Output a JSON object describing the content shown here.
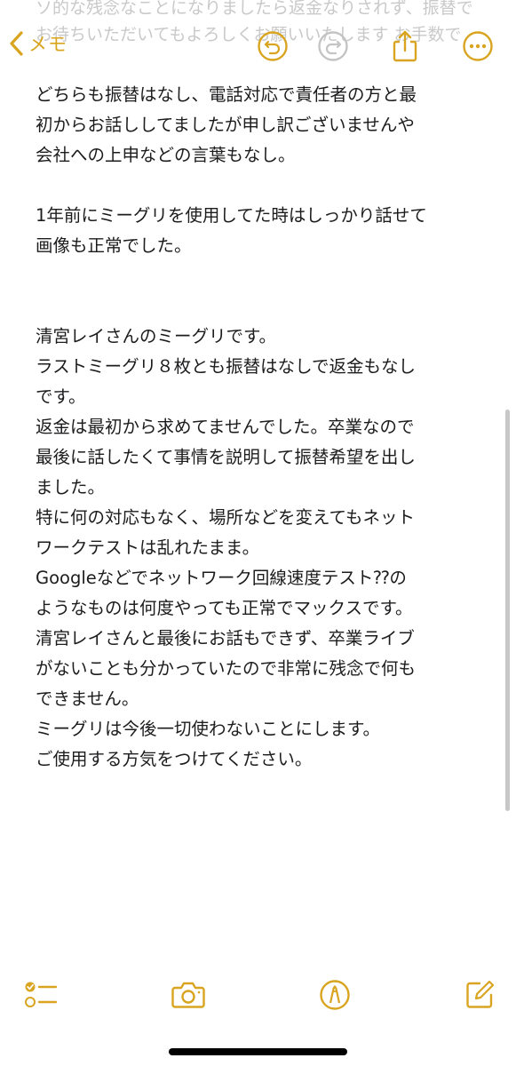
{
  "nav": {
    "back_label": "メモ"
  },
  "faded_lines": [
    "ソ的な残念なことになりましたら返金なりされず、振替で",
    "お待ちいただいてもよろしくお願いいたします お手数で"
  ],
  "note": {
    "lines": [
      "どちらも振替はなし、電話対応で責任者の方と最",
      "初からお話ししてましたが申し訳ございませんや",
      "会社への上申などの言葉もなし。",
      "",
      "1年前にミーグリを使用してた時はしっかり話せて",
      "画像も正常でした。",
      "",
      "",
      "清宮レイさんのミーグリです。",
      "ラストミーグリ８枚とも振替はなしで返金もなし",
      "です。",
      "返金は最初から求めてませんでした。卒業なので",
      "最後に話したくて事情を説明して振替希望を出し",
      "ました。",
      "特に何の対応もなく、場所などを変えてもネット",
      "ワークテストは乱れたまま。",
      "Googleなどでネットワーク回線速度テスト⁇の",
      "ようなものは何度やっても正常でマックスです。",
      "清宮レイさんと最後にお話もできず、卒業ライブ",
      "がないことも分かっていたので非常に残念で何も",
      "できません。",
      "ミーグリは今後一切使わないことにします。",
      "ご使用する方気をつけてください。"
    ]
  },
  "icons": {
    "back": "chevron-left-icon",
    "undo": "undo-icon",
    "redo": "redo-icon",
    "share": "share-icon",
    "more": "ellipsis-icon",
    "checklist": "checklist-icon",
    "camera": "camera-icon",
    "markup": "markup-pen-icon",
    "compose": "compose-icon"
  },
  "colors": {
    "accent": "#d9a520",
    "disabled": "#c4c4c4",
    "text": "#1c1c1e",
    "faded_text": "#c9c9c9"
  }
}
